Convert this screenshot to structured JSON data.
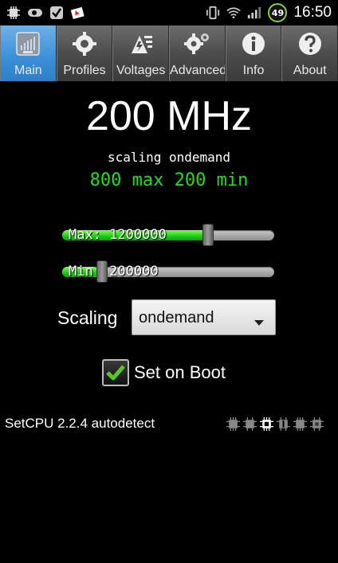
{
  "status_bar": {
    "icons": [
      "cpu-icon",
      "toggle-icon",
      "checkmark-icon",
      "photo-icon"
    ],
    "right_icons": [
      "vibrate-icon",
      "wifi-icon",
      "signal-icon"
    ],
    "battery": "49",
    "time": "16:50"
  },
  "tabs": [
    {
      "label": "Main",
      "icon": "chip-icon",
      "active": true
    },
    {
      "label": "Profiles",
      "icon": "gear-icon",
      "active": false
    },
    {
      "label": "Voltages",
      "icon": "voltage-icon",
      "active": false
    },
    {
      "label": "Advanced",
      "icon": "advanced-gear-icon",
      "active": false
    },
    {
      "label": "Info",
      "icon": "info-icon",
      "active": false
    },
    {
      "label": "About",
      "icon": "help-icon",
      "active": false
    }
  ],
  "main": {
    "frequency": "200 MHz",
    "governor_line": "scaling ondemand",
    "range_line": "800 max 200 min",
    "max_slider": {
      "label": "Max: 1200000",
      "fraction": 0.7
    },
    "min_slider": {
      "label": "Min: 200000",
      "fraction": 0.17
    },
    "scaling_label": "Scaling",
    "scaling_value": "ondemand",
    "set_on_boot_label": "Set on Boot",
    "set_on_boot_checked": true
  },
  "footer": {
    "text": "SetCPU 2.2.4 autodetect",
    "cpu_icons": [
      "cpu-icon",
      "cpu-icon",
      "cpu-icon",
      "cpu-icon",
      "cpu-icon",
      "cpu-icon"
    ]
  },
  "colors": {
    "active_tab": "#3a8fd6",
    "range_text": "#22dd22",
    "slider_fill": "#23c41a"
  }
}
